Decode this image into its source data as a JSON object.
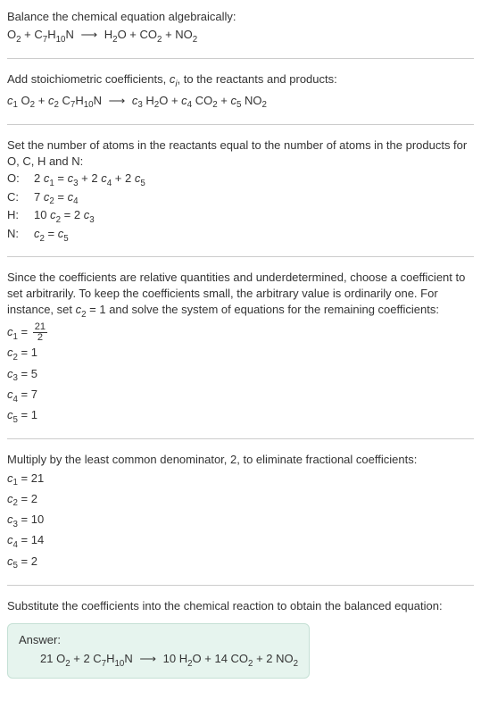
{
  "intro": {
    "line1": "Balance the chemical equation algebraically:",
    "eq_left_O2": "O",
    "eq_left_plus1": " + C",
    "eq_left_sub7": "7",
    "eq_left_H": "H",
    "eq_left_sub10": "10",
    "eq_left_N": "N",
    "arrow": "⟶",
    "eq_right_H": "H",
    "eq_right_sub2a": "2",
    "eq_right_O": "O + CO",
    "eq_right_sub2b": "2",
    "eq_right_plus_NO": " + NO",
    "eq_right_sub2c": "2"
  },
  "stoich": {
    "text_a": "Add stoichiometric coefficients, ",
    "ci_c": "c",
    "ci_i": "i",
    "text_b": ", to the reactants and products:",
    "c1": "c",
    "sub1": "1",
    "O2_O": " O",
    "O2_2": "2",
    "plus_c": " + ",
    "c2": "c",
    "sub2": "2",
    "C7H10N_C": " C",
    "C7H10N_7": "7",
    "C7H10N_H": "H",
    "C7H10N_10": "10",
    "C7H10N_N": "N",
    "arrow": "⟶",
    "c3": "c",
    "sub3": "3",
    "H2O_H": " H",
    "H2O_2": "2",
    "H2O_O": "O + ",
    "c4": "c",
    "sub4": "4",
    "CO2_CO": " CO",
    "CO2_2": "2",
    "plus2": " + ",
    "c5": "c",
    "sub5": "5",
    "NO2_NO": " NO",
    "NO2_2": "2"
  },
  "atoms": {
    "intro": "Set the number of atoms in the reactants equal to the number of atoms in the products for O, C, H and N:",
    "O_label": "O:",
    "O_eq_a": "2 ",
    "O_eq_c1": "c",
    "O_eq_s1": "1",
    "O_eq_eq": " = ",
    "O_eq_c3": "c",
    "O_eq_s3": "3",
    "O_eq_p1": " + 2 ",
    "O_eq_c4": "c",
    "O_eq_s4": "4",
    "O_eq_p2": " + 2 ",
    "O_eq_c5": "c",
    "O_eq_s5": "5",
    "C_label": "C:",
    "C_eq_a": "7 ",
    "C_eq_c2": "c",
    "C_eq_s2": "2",
    "C_eq_eq": " = ",
    "C_eq_c4": "c",
    "C_eq_s4": "4",
    "H_label": "H:",
    "H_eq_a": "10 ",
    "H_eq_c2": "c",
    "H_eq_s2": "2",
    "H_eq_eq": " = 2 ",
    "H_eq_c3": "c",
    "H_eq_s3": "3",
    "N_label": "N:",
    "N_eq_c2": "c",
    "N_eq_s2": "2",
    "N_eq_eq": " = ",
    "N_eq_c5": "c",
    "N_eq_s5": "5"
  },
  "choose": {
    "text_a": "Since the coefficients are relative quantities and underdetermined, choose a coefficient to set arbitrarily. To keep the coefficients small, the arbitrary value is ordinarily one. For instance, set ",
    "c2_c": "c",
    "c2_s": "2",
    "text_b": " = 1 and solve the system of equations for the remaining coefficients:",
    "r1_c": "c",
    "r1_s": "1",
    "r1_eq": " = ",
    "r1_num": "21",
    "r1_den": "2",
    "r2_c": "c",
    "r2_s": "2",
    "r2_v": " = 1",
    "r3_c": "c",
    "r3_s": "3",
    "r3_v": " = 5",
    "r4_c": "c",
    "r4_s": "4",
    "r4_v": " = 7",
    "r5_c": "c",
    "r5_s": "5",
    "r5_v": " = 1"
  },
  "multiply": {
    "text": "Multiply by the least common denominator, 2, to eliminate fractional coefficients:",
    "r1_c": "c",
    "r1_s": "1",
    "r1_v": " = 21",
    "r2_c": "c",
    "r2_s": "2",
    "r2_v": " = 2",
    "r3_c": "c",
    "r3_s": "3",
    "r3_v": " = 10",
    "r4_c": "c",
    "r4_s": "4",
    "r4_v": " = 14",
    "r5_c": "c",
    "r5_s": "5",
    "r5_v": " = 2"
  },
  "final": {
    "text": "Substitute the coefficients into the chemical reaction to obtain the balanced equation:",
    "answer_label": "Answer:",
    "eq_21O2_21": "21 O",
    "eq_21O2_2": "2",
    "eq_plus1": " + 2 C",
    "eq_C7_7": "7",
    "eq_H": "H",
    "eq_H10_10": "10",
    "eq_N": "N",
    "arrow": "⟶",
    "eq_10H2O_10H": "10 H",
    "eq_10H2O_2": "2",
    "eq_O": "O + 14 CO",
    "eq_CO2_2": "2",
    "eq_plus2": " + 2 NO",
    "eq_NO2_2": "2"
  }
}
